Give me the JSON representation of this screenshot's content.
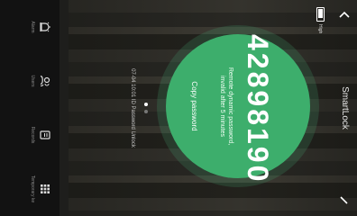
{
  "header": {
    "title": "SmartLock"
  },
  "battery": {
    "label": "High",
    "level_percent": 80
  },
  "password": {
    "code": "42898190",
    "hint": "Remote dynamic password, invalid after 5 minutes",
    "copy_label": "Copy password"
  },
  "pager": {
    "count": 2,
    "active_index": 0
  },
  "log": {
    "text": "07-04 10:01  ID Password Unlock"
  },
  "nav": [
    {
      "label": "Alarm",
      "icon": "alarm-icon"
    },
    {
      "label": "Users",
      "icon": "users-icon"
    },
    {
      "label": "Records",
      "icon": "records-icon"
    },
    {
      "label": "Temporary ke",
      "icon": "keypad-icon"
    }
  ]
}
